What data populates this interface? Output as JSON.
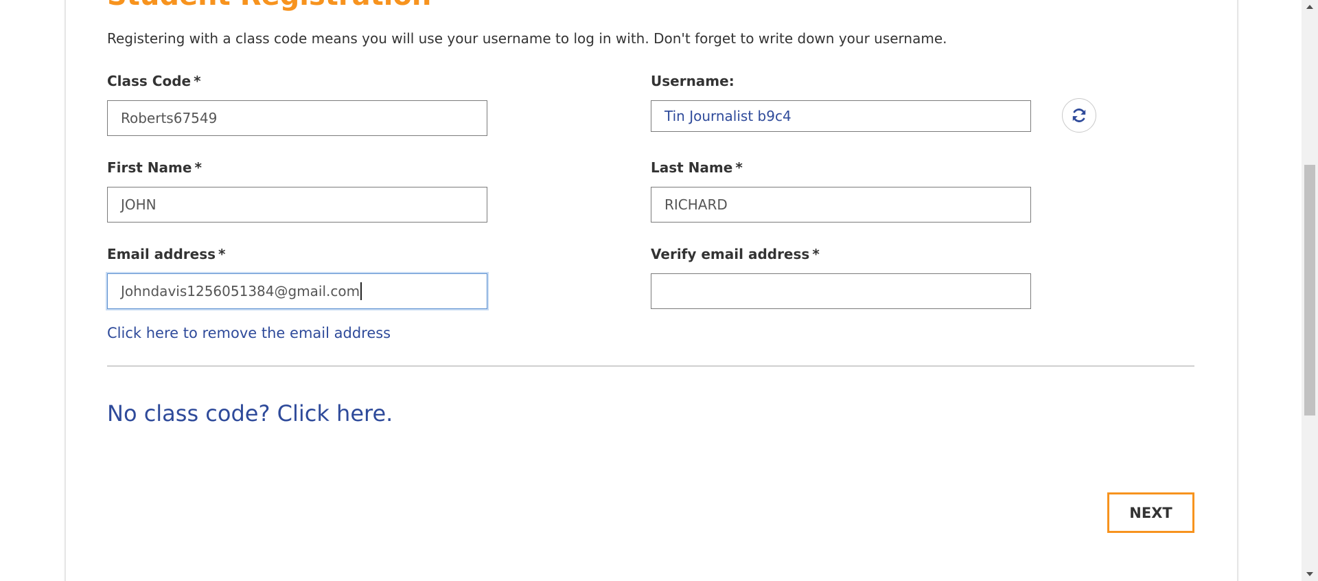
{
  "form": {
    "title": "Student Registration",
    "intro": "Registering with a class code means you will use your username to log in with. Don't forget to write down your username.",
    "required_marker": "*",
    "class_code": {
      "label": "Class Code",
      "value": "Roberts67549"
    },
    "username": {
      "label": "Username:",
      "value": "Tin Journalist b9c4",
      "refresh_icon": "refresh-icon"
    },
    "first_name": {
      "label": "First Name",
      "value": "JOHN"
    },
    "last_name": {
      "label": "Last Name",
      "value": "RICHARD"
    },
    "email": {
      "label": "Email address",
      "value": "Johndavis1256051384@gmail.com"
    },
    "verify_email": {
      "label": "Verify email address",
      "value": ""
    },
    "remove_email_link": "Click here to remove the email address",
    "no_class_code_link": "No class code? Click here.",
    "next_button": "NEXT"
  },
  "colors": {
    "accent_orange": "#f7931e",
    "link_blue": "#2e4a9a",
    "text": "#333333",
    "focus_border": "#5b8fd0"
  }
}
